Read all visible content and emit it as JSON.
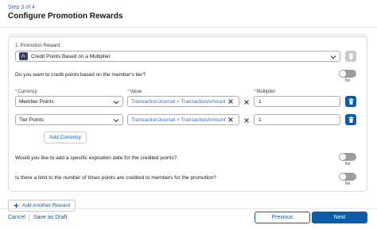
{
  "header": {
    "step_label": "Step 3 of 4",
    "title": "Configure Promotion Rewards"
  },
  "reward": {
    "section_label": "1.  Promotion Reward",
    "type_value": "Credit Points Based on a Multiplier",
    "type_icon": "fx",
    "tier_question": "Do you want to credit points based on the member's tier?",
    "tier_toggle_label": "No",
    "tier_toggle_on": false,
    "currency_label": "Currency",
    "value_label": "Value",
    "multiplier_label": "Multiplier",
    "rows": [
      {
        "currency": "Member Points",
        "value": "TransactionJournal > TransactionAmount",
        "multiplier": "1"
      },
      {
        "currency": "Tier Points",
        "value": "TransactionJournal > TransactionAmount",
        "multiplier": "1"
      }
    ],
    "add_currency_label": "Add Currency",
    "expiration_question": "Would you like to add a specific expiration date for the credited points?",
    "expiration_toggle_label": "No",
    "expiration_toggle_on": false,
    "limit_question": "Is there a limit to the number of times points are credited to members for the promotion?",
    "limit_toggle_label": "No",
    "limit_toggle_on": false
  },
  "add_another_reward_label": "Add Another Reward",
  "footer": {
    "cancel_label": "Cancel",
    "save_draft_label": "Save as Draft",
    "previous_label": "Previous",
    "next_label": "Next"
  },
  "colors": {
    "brand": "#0b5cab",
    "link_text": "#2e6fd6",
    "toggle_off": "#9d9d9d",
    "required": "#c23934"
  }
}
